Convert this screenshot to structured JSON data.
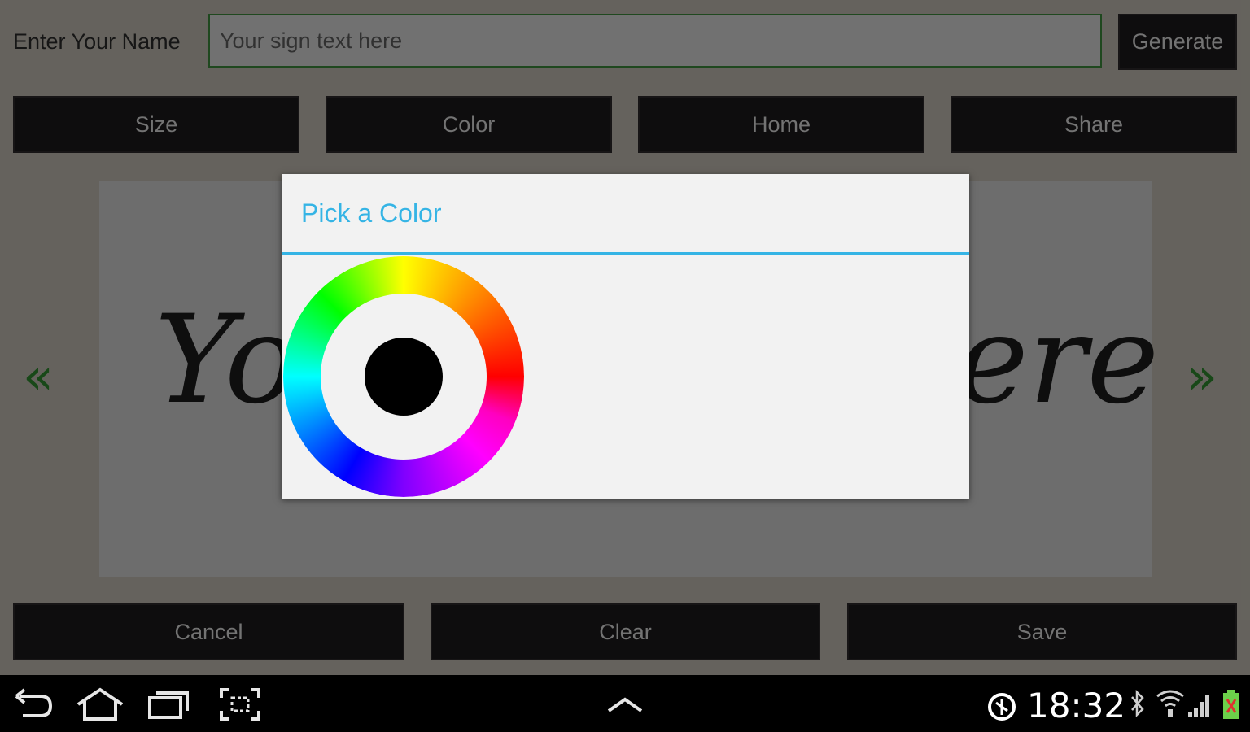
{
  "header": {
    "name_label": "Enter Your Name",
    "input_placeholder": "Your sign text here",
    "input_value": "",
    "generate_label": "Generate"
  },
  "toolbar": {
    "size_label": "Size",
    "color_label": "Color",
    "home_label": "Home",
    "share_label": "Share"
  },
  "preview": {
    "signature_left": "Yo",
    "signature_right": "ere",
    "prev_arrow": "«",
    "next_arrow": "»"
  },
  "footer": {
    "cancel_label": "Cancel",
    "clear_label": "Clear",
    "save_label": "Save"
  },
  "dialog": {
    "title": "Pick a Color",
    "accent_color": "#35b4e5",
    "selected_color": "#000000"
  },
  "system_bar": {
    "time": "18:32",
    "icons": [
      "back-icon",
      "home-icon",
      "recent-apps-icon",
      "screenshot-icon",
      "up-chevron-icon",
      "accessibility-icon",
      "bluetooth-icon",
      "wifi-icon",
      "signal-icon",
      "battery-icon"
    ]
  },
  "colors": {
    "button_bg": "#1c1a1b",
    "input_border": "#3d8b3d",
    "arrow_color": "#2f8a2f"
  }
}
